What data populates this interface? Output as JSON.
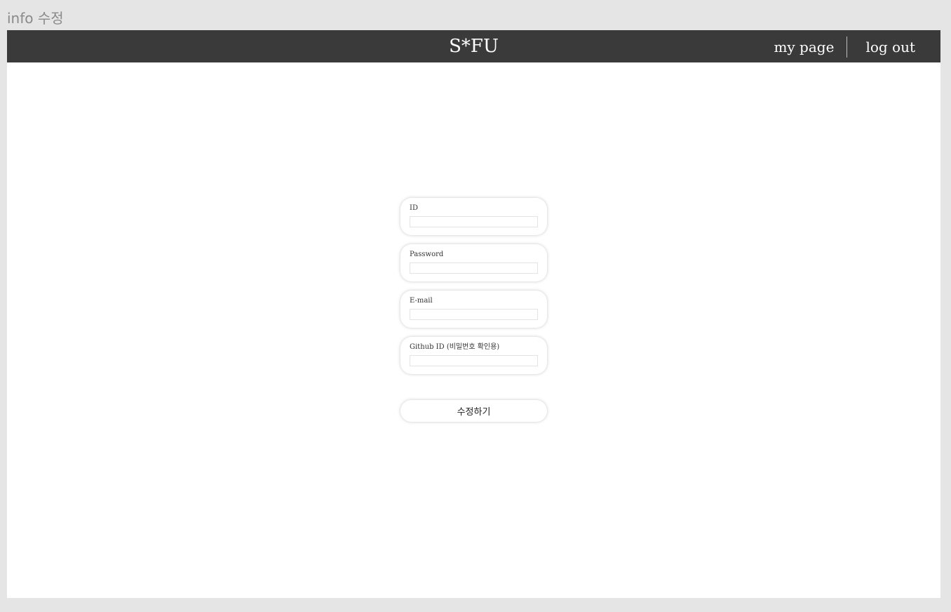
{
  "frame_title": "info 수정",
  "header": {
    "brand": "S*FU",
    "nav": {
      "my_page": "my page",
      "log_out": "log out"
    }
  },
  "form": {
    "fields": [
      {
        "label": "ID",
        "value": ""
      },
      {
        "label": "Password",
        "value": ""
      },
      {
        "label": "E-mail",
        "value": ""
      },
      {
        "label": "Github ID (비밀번호 확인용)",
        "value": ""
      }
    ],
    "submit_label": "수정하기"
  },
  "colors": {
    "header_bg": "#3a3a3a",
    "canvas_bg": "#e5e5e5",
    "page_bg": "#ffffff"
  }
}
